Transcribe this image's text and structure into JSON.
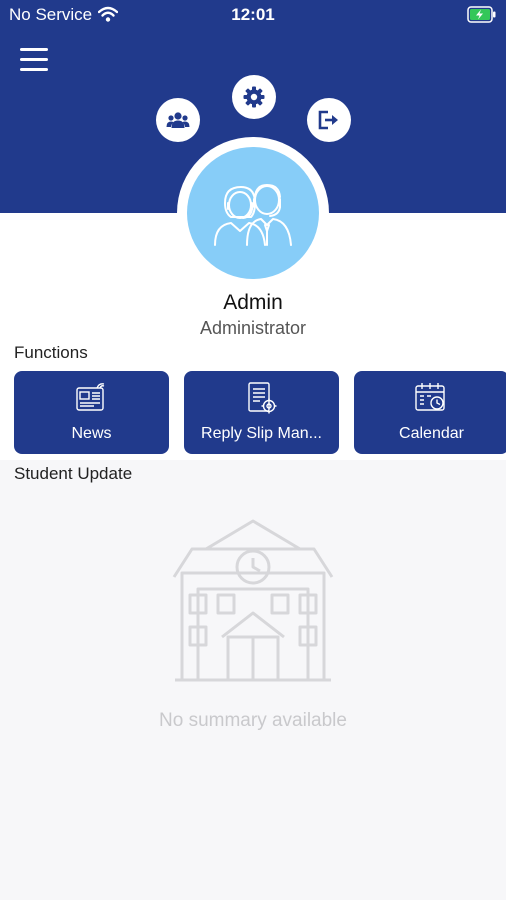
{
  "status_bar": {
    "carrier": "No Service",
    "time": "12:01",
    "wifi_icon": "wifi-icon",
    "battery_icon": "battery-charging-icon"
  },
  "header": {
    "menu_icon": "hamburger-menu-icon",
    "actions": [
      {
        "icon": "users-icon"
      },
      {
        "icon": "gear-icon"
      },
      {
        "icon": "logout-icon"
      }
    ],
    "colors": {
      "primary": "#213a8c",
      "avatar_bg": "#87cdf8"
    }
  },
  "profile": {
    "avatar_icon": "support-agents-icon",
    "name": "Admin",
    "role": "Administrator"
  },
  "functions": {
    "title": "Functions",
    "items": [
      {
        "label": "News",
        "icon": "newspaper-icon"
      },
      {
        "label": "Reply Slip Man...",
        "icon": "document-gear-icon"
      },
      {
        "label": "Calendar",
        "icon": "calendar-clock-icon"
      }
    ]
  },
  "student_update": {
    "title": "Student Update",
    "empty_icon": "school-building-icon",
    "empty_text": "No summary available"
  }
}
